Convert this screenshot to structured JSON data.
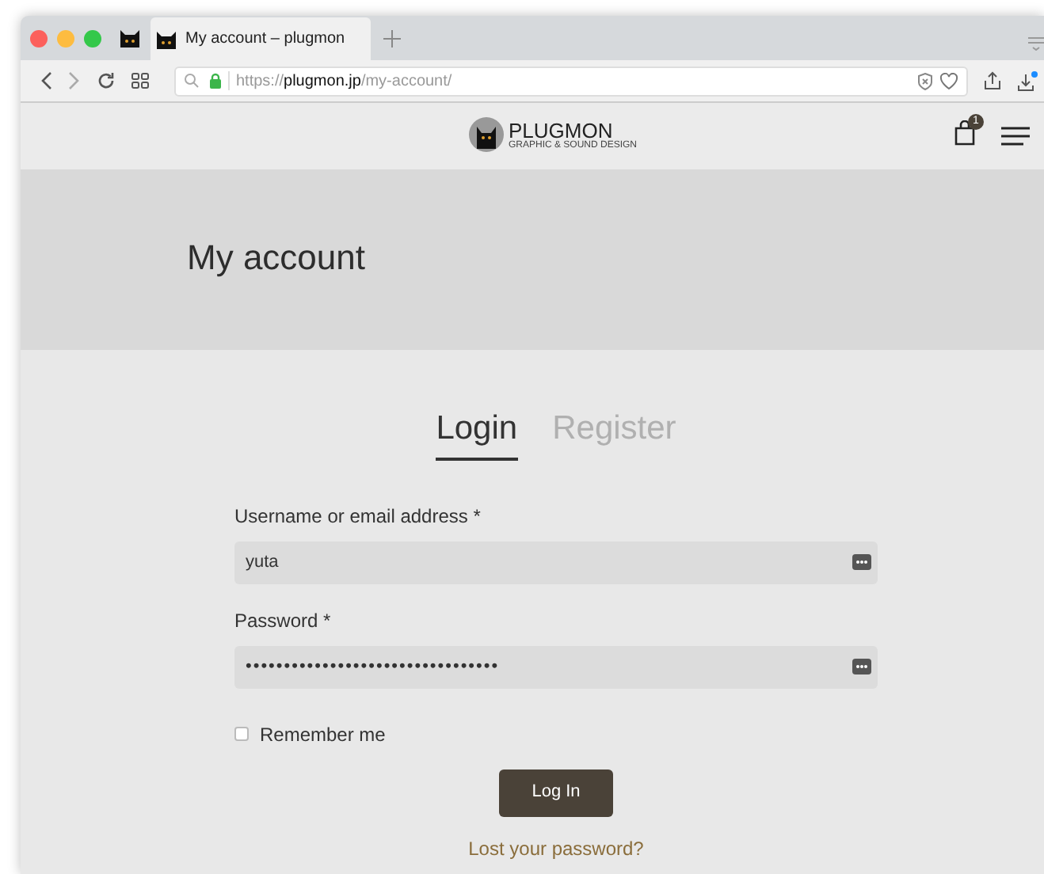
{
  "browser": {
    "tab_title": "My account – plugmon",
    "url_host": "plugmon.jp",
    "url_scheme": "https://",
    "url_path": "/my-account/"
  },
  "header": {
    "logo_name": "PLUGMON",
    "logo_tagline": "GRAPHIC & SOUND DESIGN",
    "cart_count": "1"
  },
  "page_title": "My account",
  "tabs": [
    {
      "label": "Login",
      "selected": true
    },
    {
      "label": "Register",
      "selected": false
    }
  ],
  "fields": [
    {
      "label": "Username or email address *",
      "value": "yuta"
    },
    {
      "label": "Password *",
      "value": "•••••••••••••••••••••••••••••••••"
    }
  ],
  "remember": {
    "label": "Remember me",
    "checked": false
  },
  "submit": "Log In",
  "lost_password": "Lost your password?"
}
